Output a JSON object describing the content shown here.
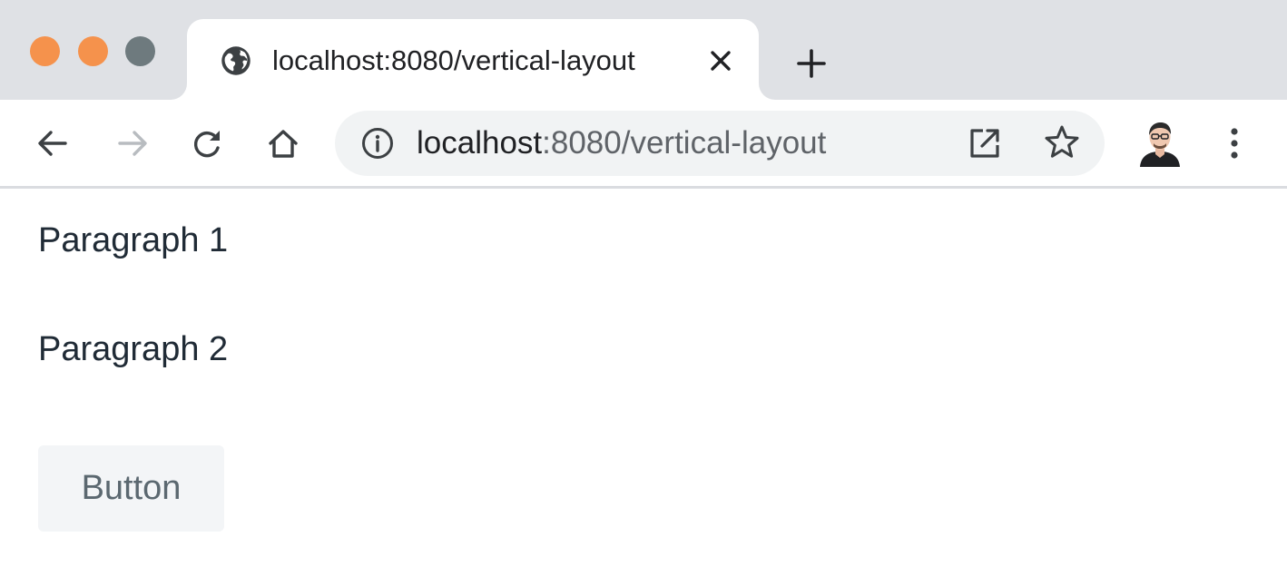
{
  "window": {
    "controls": {
      "close_color": "#f5924c",
      "minimize_color": "#f5924c",
      "maximize_color": "#6e7a7e"
    }
  },
  "tab": {
    "title": "localhost:8080/vertical-layout",
    "favicon": "globe-icon",
    "close_icon": "close-icon"
  },
  "new_tab": {
    "icon": "plus-icon"
  },
  "toolbar": {
    "icons": [
      "back-arrow-icon",
      "forward-arrow-icon",
      "reload-icon",
      "home-icon",
      "info-icon",
      "open-external-icon",
      "star-icon",
      "avatar",
      "more-vert-icon"
    ],
    "address": {
      "host": "localhost",
      "rest": ":8080/vertical-layout"
    }
  },
  "page": {
    "paragraph_1": "Paragraph 1",
    "paragraph_2": "Paragraph 2",
    "button_label": "Button"
  },
  "colors": {
    "tabstrip_bg": "#dfe1e5",
    "omnibox_bg": "#f1f3f4",
    "text": "#202b36",
    "button_bg": "#f3f5f7",
    "button_text": "#5b6870"
  }
}
